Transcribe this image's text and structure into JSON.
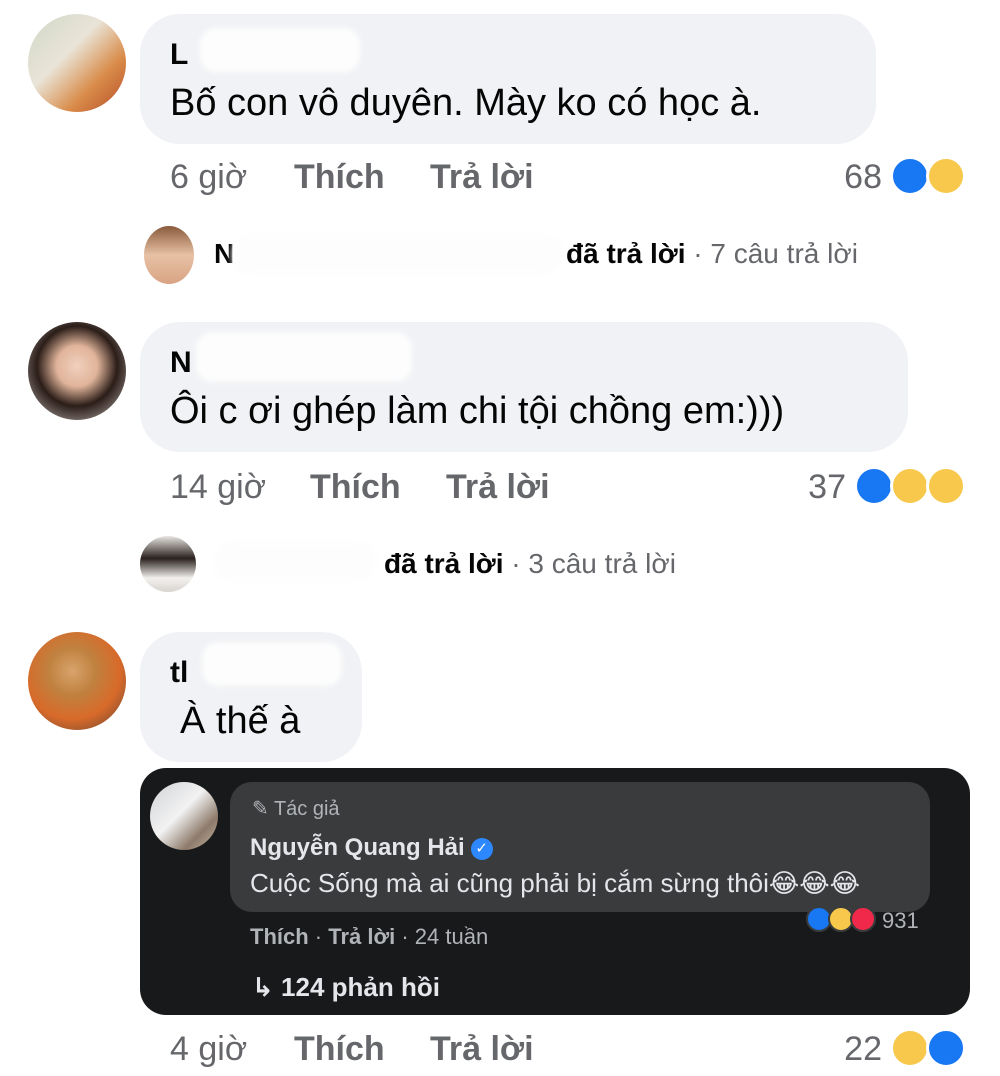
{
  "comments": [
    {
      "name": "L",
      "text": "Bố con vô duyên. Mày ko có học à.",
      "time": "6 giờ",
      "like": "Thích",
      "reply": "Trả lời",
      "reaction_count": "68",
      "reactions": [
        "like-icon",
        "haha-icon"
      ],
      "replies_summary": {
        "name": "N",
        "action": "đã trả lời",
        "count": "· 7 câu trả lời"
      }
    },
    {
      "name": "N",
      "text": "Ôi c ơi ghép làm chi tội chồng em:)))",
      "time": "14 giờ",
      "like": "Thích",
      "reply": "Trả lời",
      "reaction_count": "37",
      "reactions": [
        "like-icon",
        "haha-icon",
        "sad-icon"
      ],
      "replies_summary": {
        "name": "",
        "action": "đã trả lời",
        "count": "· 3 câu trả lời"
      }
    },
    {
      "name": "tl",
      "text": "À thế à",
      "time": "4 giờ",
      "like": "Thích",
      "reply": "Trả lời",
      "reaction_count": "22",
      "reactions": [
        "haha-icon",
        "like-icon"
      ]
    }
  ],
  "embedded_screenshot": {
    "author_badge": "Tác giả",
    "name": "Nguyễn Quang Hải",
    "text": "Cuộc Sống mà ai cũng phải bị cắm sừng thôi😂😂😂",
    "like": "Thích",
    "reply": "Trả lời",
    "time": "24 tuần",
    "reaction_count": "931",
    "replies": "124 phản hồi"
  },
  "colors": {
    "bubble": "#f0f2f5",
    "meta_text": "#65676b",
    "like_blue": "#1877f2",
    "haha_yellow": "#f7c84b",
    "dark_bg": "#18191a",
    "dark_bubble": "#3a3b3c"
  }
}
